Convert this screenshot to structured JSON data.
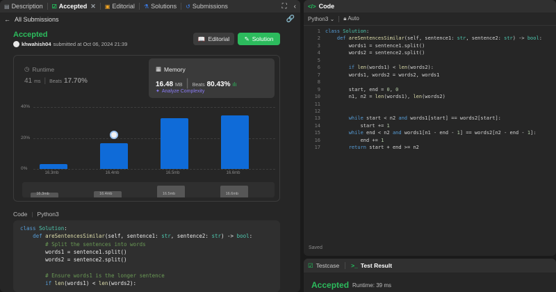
{
  "left_tabs": [
    {
      "label": "Description",
      "icon": "description-icon"
    },
    {
      "label": "Accepted",
      "icon": "check-icon",
      "active": true
    },
    {
      "label": "Editorial",
      "icon": "book-icon"
    },
    {
      "label": "Solutions",
      "icon": "flask-icon"
    },
    {
      "label": "Submissions",
      "icon": "history-icon"
    }
  ],
  "back_label": "All Submissions",
  "result": {
    "status": "Accepted",
    "user": "khwahish04",
    "submitted_text": "submitted at Oct 06, 2024 21:39"
  },
  "buttons": {
    "editorial": "Editorial",
    "solution": "Solution"
  },
  "runtime": {
    "label": "Runtime",
    "value": "41",
    "unit": "ms",
    "beats_label": "Beats",
    "beats_pct": "17.70%"
  },
  "memory": {
    "label": "Memory",
    "value": "16.48",
    "unit": "MB",
    "beats_label": "Beats",
    "beats_pct": "80.43%",
    "analyze_label": "Analyze Complexity"
  },
  "chart_data": {
    "type": "bar",
    "categories": [
      "16.3mb",
      "16.4mb",
      "16.5mb",
      "16.6mb"
    ],
    "values": [
      3,
      16.5,
      33,
      34.5
    ],
    "highlighted_category": "16.4mb",
    "y_ticks": [
      "40%",
      "20%",
      "0%"
    ],
    "ylim": [
      0,
      40
    ],
    "grid": true,
    "accent_color": "#0f6bd8"
  },
  "mini_chart": {
    "labels": [
      "16.3mb",
      "16.4mb",
      "16.5mb",
      "16.6mb"
    ],
    "values": [
      0.35,
      0.45,
      0.85,
      0.85
    ]
  },
  "code_section": {
    "label": "Code",
    "language": "Python3"
  },
  "left_code": [
    [
      {
        "t": "class ",
        "c": "kw"
      },
      {
        "t": "Solution",
        "c": "cls"
      },
      {
        "t": ":"
      }
    ],
    [
      {
        "t": "    "
      },
      {
        "t": "def ",
        "c": "kw"
      },
      {
        "t": "areSentencesSimilar",
        "c": "fn"
      },
      {
        "t": "(self, sentence1: "
      },
      {
        "t": "str",
        "c": "ty"
      },
      {
        "t": ", sentence2: "
      },
      {
        "t": "str",
        "c": "ty"
      },
      {
        "t": ") -> "
      },
      {
        "t": "bool",
        "c": "ty"
      },
      {
        "t": ":"
      }
    ],
    [
      {
        "t": "        "
      },
      {
        "t": "# Split the sentences into words",
        "c": "cm"
      }
    ],
    [
      {
        "t": "        words1 = sentence1.split()"
      }
    ],
    [
      {
        "t": "        words2 = sentence2.split()"
      }
    ],
    [
      {
        "t": ""
      }
    ],
    [
      {
        "t": "        "
      },
      {
        "t": "# Ensure words1 is the longer sentence",
        "c": "cm"
      }
    ],
    [
      {
        "t": "        "
      },
      {
        "t": "if ",
        "c": "kw"
      },
      {
        "t": "len",
        "c": "fn"
      },
      {
        "t": "(words1) < "
      },
      {
        "t": "len",
        "c": "fn"
      },
      {
        "t": "(words2):"
      }
    ]
  ],
  "right_panel": {
    "title": "Code",
    "language": "Python3",
    "mode": "Auto",
    "saved": "Saved"
  },
  "editor_lines": [
    [
      {
        "t": "class ",
        "c": "kw"
      },
      {
        "t": "Solution",
        "c": "cls"
      },
      {
        "t": ":"
      }
    ],
    [
      {
        "t": "    "
      },
      {
        "t": "def ",
        "c": "kw"
      },
      {
        "t": "areSentencesSimilar",
        "c": "fn"
      },
      {
        "t": "(self, sentence1: "
      },
      {
        "t": "str",
        "c": "ty"
      },
      {
        "t": ", sentence2: "
      },
      {
        "t": "str",
        "c": "ty"
      },
      {
        "t": ") -> "
      },
      {
        "t": "bool",
        "c": "ty"
      },
      {
        "t": ":"
      }
    ],
    [
      {
        "t": "        words1 = sentence1.split()"
      }
    ],
    [
      {
        "t": "        words2 = sentence2.split()"
      }
    ],
    [
      {
        "t": ""
      }
    ],
    [
      {
        "t": "        "
      },
      {
        "t": "if ",
        "c": "kw"
      },
      {
        "t": "len",
        "c": "fn"
      },
      {
        "t": "(words1) < "
      },
      {
        "t": "len",
        "c": "fn"
      },
      {
        "t": "(words2):"
      }
    ],
    [
      {
        "t": "        words1, words2 = words2, words1"
      }
    ],
    [
      {
        "t": ""
      }
    ],
    [
      {
        "t": "        start, end = "
      },
      {
        "t": "0",
        "c": "num"
      },
      {
        "t": ", "
      },
      {
        "t": "0",
        "c": "num"
      }
    ],
    [
      {
        "t": "        n1, n2 = "
      },
      {
        "t": "len",
        "c": "fn"
      },
      {
        "t": "(words1), "
      },
      {
        "t": "len",
        "c": "fn"
      },
      {
        "t": "(words2)"
      }
    ],
    [
      {
        "t": ""
      }
    ],
    [
      {
        "t": ""
      }
    ],
    [
      {
        "t": "        "
      },
      {
        "t": "while ",
        "c": "kw"
      },
      {
        "t": "start < n2 "
      },
      {
        "t": "and ",
        "c": "kw"
      },
      {
        "t": "words1[start] == words2[start]:"
      }
    ],
    [
      {
        "t": "            start += "
      },
      {
        "t": "1",
        "c": "num"
      }
    ],
    [
      {
        "t": "        "
      },
      {
        "t": "while ",
        "c": "kw"
      },
      {
        "t": "end < n2 "
      },
      {
        "t": "and ",
        "c": "kw"
      },
      {
        "t": "words1[n1 - end - "
      },
      {
        "t": "1",
        "c": "num"
      },
      {
        "t": "] == words2[n2 - end - "
      },
      {
        "t": "1",
        "c": "num"
      },
      {
        "t": "]:"
      }
    ],
    [
      {
        "t": "            end += "
      },
      {
        "t": "1",
        "c": "num"
      }
    ],
    [
      {
        "t": "        "
      },
      {
        "t": "return ",
        "c": "kw"
      },
      {
        "t": "start + end >= n2"
      }
    ]
  ],
  "bottom_panel": {
    "tab_testcase": "Testcase",
    "tab_result": "Test Result",
    "status": "Accepted",
    "runtime": "Runtime: 39 ms"
  },
  "colors": {
    "accent_green": "#2cbb5d",
    "bar_blue": "#0f6bd8",
    "purple": "#8b7cf6"
  }
}
